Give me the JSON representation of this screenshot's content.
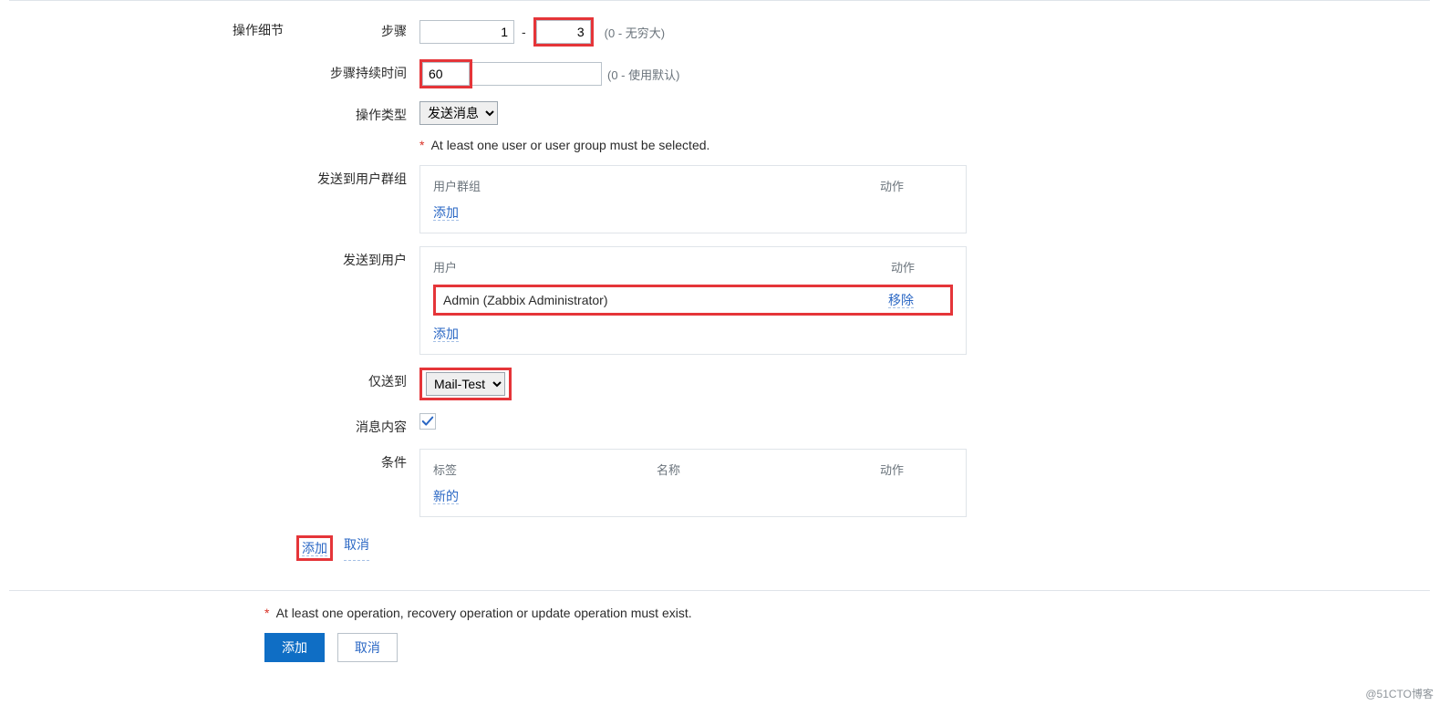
{
  "section": {
    "title": "操作细节"
  },
  "steps": {
    "label": "步骤",
    "from": "1",
    "to": "3",
    "hint": "(0 - 无穷大)"
  },
  "duration": {
    "label": "步骤持续时间",
    "value": "60",
    "hint": "(0 - 使用默认)"
  },
  "opType": {
    "label": "操作类型",
    "selected": "发送消息"
  },
  "validation": {
    "userRequired": "At least one user or user group must be selected."
  },
  "userGroups": {
    "label": "发送到用户群组",
    "header1": "用户群组",
    "header2": "动作",
    "add": "添加"
  },
  "users": {
    "label": "发送到用户",
    "header1": "用户",
    "header2": "动作",
    "row_name": "Admin (Zabbix Administrator)",
    "row_action": "移除",
    "add": "添加"
  },
  "sendTo": {
    "label": "仅送到",
    "selected": "Mail-Test"
  },
  "msgContent": {
    "label": "消息内容",
    "checked": true
  },
  "conditions": {
    "label": "条件",
    "header1": "标签",
    "header2": "名称",
    "header3": "动作",
    "new": "新的"
  },
  "detailActions": {
    "add": "添加",
    "cancel": "取消"
  },
  "footer": {
    "validation": "At least one operation, recovery operation or update operation must exist.",
    "add": "添加",
    "cancel": "取消"
  },
  "watermark": "@51CTO博客"
}
